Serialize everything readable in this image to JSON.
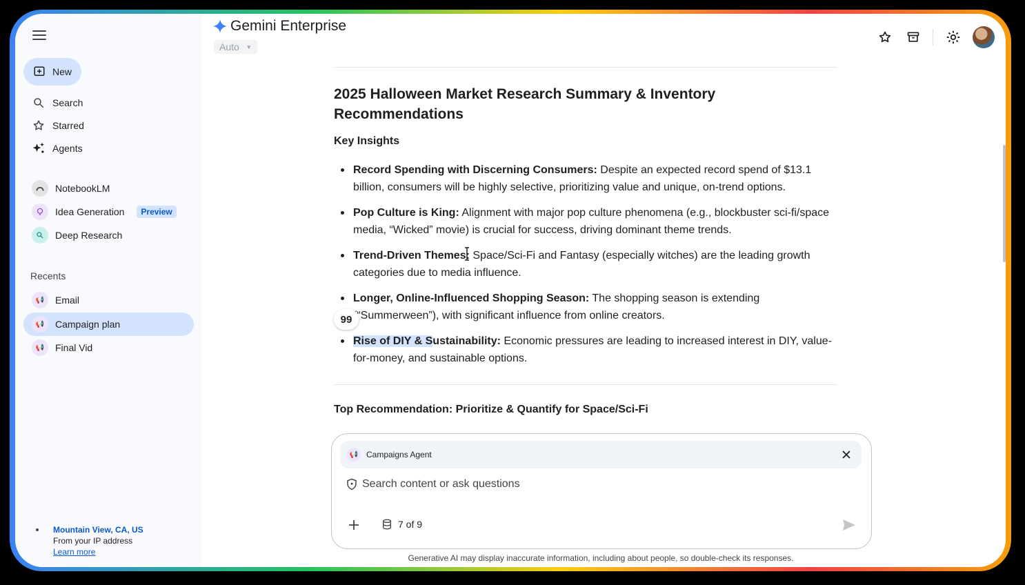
{
  "app": {
    "title": "Gemini Enterprise",
    "model": "Auto"
  },
  "sidebar": {
    "new_label": "New",
    "nav": [
      {
        "label": "Search",
        "icon": "search-icon"
      },
      {
        "label": "Starred",
        "icon": "star-icon"
      },
      {
        "label": "Agents",
        "icon": "agents-sparkle-icon"
      }
    ],
    "apps": [
      {
        "label": "NotebookLM",
        "icon": "notebooklm-icon"
      },
      {
        "label": "Idea Generation",
        "icon": "lightbulb-icon",
        "badge": "Preview"
      },
      {
        "label": "Deep Research",
        "icon": "deep-research-icon"
      }
    ],
    "recents_label": "Recents",
    "recents": [
      {
        "label": "Email",
        "icon": "megaphone-icon"
      },
      {
        "label": "Campaign plan",
        "icon": "megaphone-icon",
        "active": true
      },
      {
        "label": "Final Vid",
        "icon": "megaphone-icon"
      }
    ],
    "location": {
      "city": "Mountain View, CA, US",
      "source": "From your IP address",
      "link": "Learn more"
    }
  },
  "report": {
    "title": "2025 Halloween Market Research Summary & Inventory Recommendations",
    "section1": "Key Insights",
    "insights": [
      {
        "bold": "Record Spending with Discerning Consumers:",
        "text": " Despite an expected record spend of $13.1 billion, consumers will be highly selective, prioritizing value and unique, on-trend options."
      },
      {
        "bold": "Pop Culture is King:",
        "text": " Alignment with major pop culture phenomena (e.g., blockbuster sci-fi/space media, “Wicked” movie) is crucial for success, driving dominant theme trends."
      },
      {
        "bold": "Trend-Driven Themes:",
        "text": " Space/Sci-Fi and Fantasy (especially witches) are the leading growth categories due to media influence."
      },
      {
        "bold": "Longer, Online-Influenced Shopping Season:",
        "text": " The shopping season is extending (“Summerween”), with significant influence from online creators."
      },
      {
        "bold_highlight": "Rise of DIY & S",
        "bold": "ustainability:",
        "text": " Economic pressures are leading to increased interest in DIY, value-for-money, and sustainable options."
      }
    ],
    "citation_marker": "99",
    "section2": "Top Recommendation: Prioritize & Quantify for Space/Sci-Fi"
  },
  "composer": {
    "agent": "Campaigns Agent",
    "placeholder": "Search content or ask questions",
    "sources": "7 of 9"
  },
  "disclaimer": "Generative AI may display inaccurate information, including about people, so double-check its responses.",
  "colors": {
    "accent": "#0b57d0",
    "active_bg": "#d3e3fd",
    "sidebar_bg": "#f8fafd"
  }
}
